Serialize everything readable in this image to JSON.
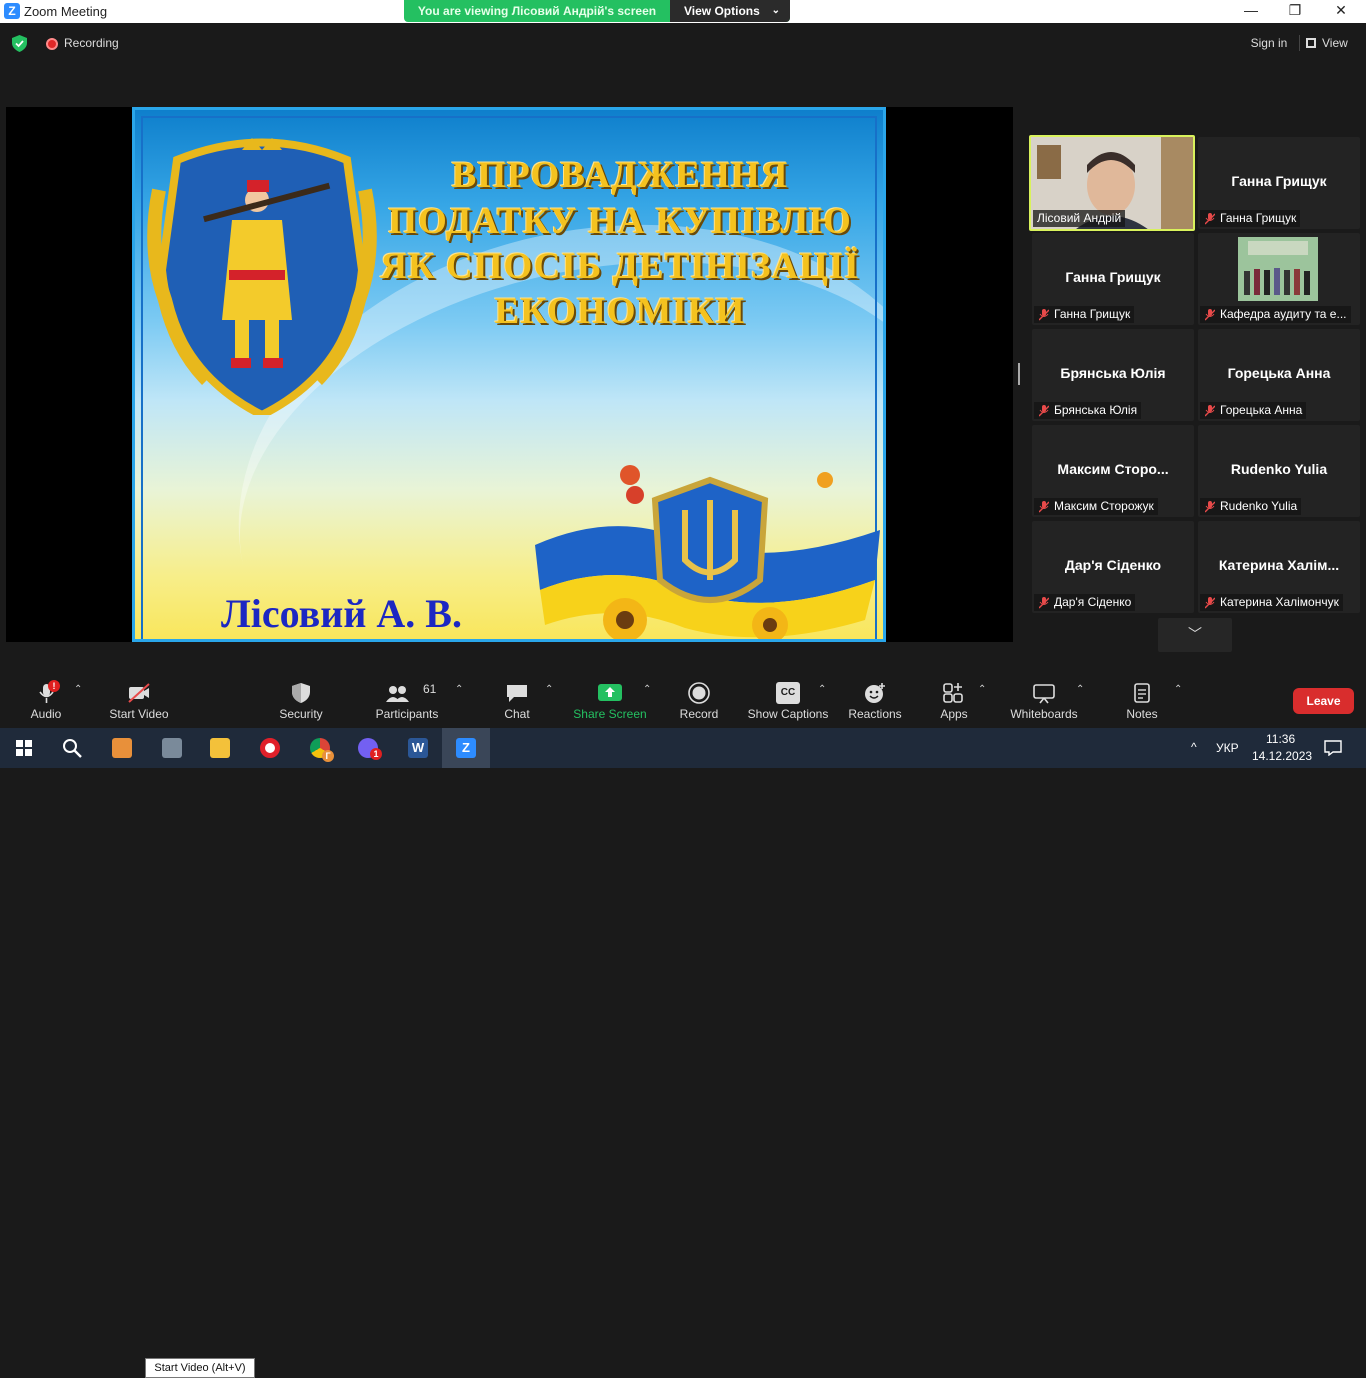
{
  "window": {
    "title": "Zoom Meeting",
    "app_icon": "Z",
    "minimize": "—",
    "restore": "❐",
    "close": "✕"
  },
  "banner": {
    "viewing_text": "You are viewing Лісовий Андрій's screen",
    "view_options_label": "View Options"
  },
  "topbar": {
    "recording_label": "Recording",
    "sign_in_label": "Sign in",
    "view_label": "View"
  },
  "slide": {
    "title_lines": [
      "ВПРОВАДЖЕННЯ",
      "ПОДАТКУ НА КУПІВЛЮ",
      "ЯК СПОСІБ ДЕТІНІЗАЦІЇ",
      "ЕКОНОМІКИ"
    ],
    "author": "Лісовий А. В."
  },
  "participants": [
    {
      "big_name": "",
      "label": "Лісовий Андрій",
      "video": true,
      "muted": false,
      "active": true
    },
    {
      "big_name": "Ганна Грищук",
      "label": "Ганна Грищук",
      "video": false,
      "muted": true
    },
    {
      "big_name": "Ганна Грищук",
      "label": "Ганна Грищук",
      "video": false,
      "muted": true
    },
    {
      "big_name": "",
      "label": "Кафедра аудиту та е...",
      "video": true,
      "muted": true,
      "photo": true
    },
    {
      "big_name": "Брянська Юлія",
      "label": "Брянська Юлія",
      "video": false,
      "muted": true
    },
    {
      "big_name": "Горецька Анна",
      "label": "Горецька Анна",
      "video": false,
      "muted": true
    },
    {
      "big_name": "Максим  Сторо...",
      "label": "Максим Сторожук",
      "video": false,
      "muted": true
    },
    {
      "big_name": "Rudenko Yulia",
      "label": "Rudenko Yulia",
      "video": false,
      "muted": true
    },
    {
      "big_name": "Дар'я Сіденко",
      "label": "Дар'я Сіденко",
      "video": false,
      "muted": true
    },
    {
      "big_name": "Катерина  Халім...",
      "label": "Катерина Халімончук",
      "video": false,
      "muted": true
    }
  ],
  "toolbar": {
    "audio": "Audio",
    "start_video": "Start Video",
    "start_video_tooltip": "Start Video (Alt+V)",
    "security": "Security",
    "participants": "Participants",
    "participants_count": "61",
    "chat": "Chat",
    "share_screen": "Share Screen",
    "record": "Record",
    "show_captions": "Show Captions",
    "captions_icon_text": "CC",
    "reactions": "Reactions",
    "apps": "Apps",
    "whiteboards": "Whiteboards",
    "notes": "Notes",
    "leave": "Leave",
    "audio_badge": "!"
  },
  "taskbar": {
    "language": "УКР",
    "time": "11:36",
    "date": "14.12.2023",
    "viber_badge": "1",
    "chrome_badge": "Г",
    "word_letter": "W",
    "zoom_letter": "Z"
  },
  "colors": {
    "accent_green": "#24c061",
    "leave_red": "#d92d2d",
    "active_speaker": "#d9f25c",
    "slide_title": "#f4c21f",
    "slide_author": "#1c27c2"
  }
}
